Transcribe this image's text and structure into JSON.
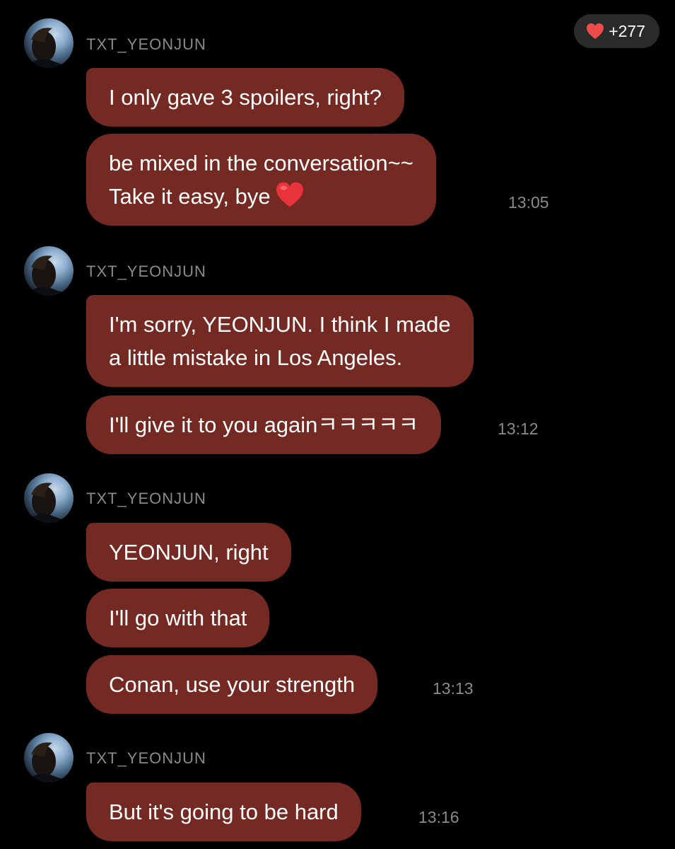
{
  "like_badge": {
    "count": "+277",
    "icon": "heart-icon",
    "color": "#f04b4b"
  },
  "colors": {
    "background": "#000000",
    "bubble": "#742a22",
    "meta_text": "#8a8a8a"
  },
  "groups": [
    {
      "sender": "TXT_YEONJUN",
      "messages": [
        {
          "lines": [
            "I only gave 3 spoilers, right?"
          ]
        },
        {
          "lines": [
            "be mixed in the conversation~~",
            "Take it easy, bye"
          ],
          "emoji": "heart-icon"
        }
      ],
      "time": "13:05"
    },
    {
      "sender": "TXT_YEONJUN",
      "messages": [
        {
          "lines": [
            "I'm sorry, YEONJUN. I think I made",
            "a little mistake in Los Angeles."
          ]
        },
        {
          "lines": [
            "I'll give it to you againㅋㅋㅋㅋㅋ"
          ]
        }
      ],
      "time": "13:12"
    },
    {
      "sender": "TXT_YEONJUN",
      "messages": [
        {
          "lines": [
            "YEONJUN, right"
          ]
        },
        {
          "lines": [
            "I'll go with that"
          ]
        },
        {
          "lines": [
            "Conan, use your strength"
          ]
        }
      ],
      "time": "13:13"
    },
    {
      "sender": "TXT_YEONJUN",
      "messages": [
        {
          "lines": [
            "But it's going to be hard"
          ]
        }
      ],
      "time": "13:16"
    }
  ]
}
